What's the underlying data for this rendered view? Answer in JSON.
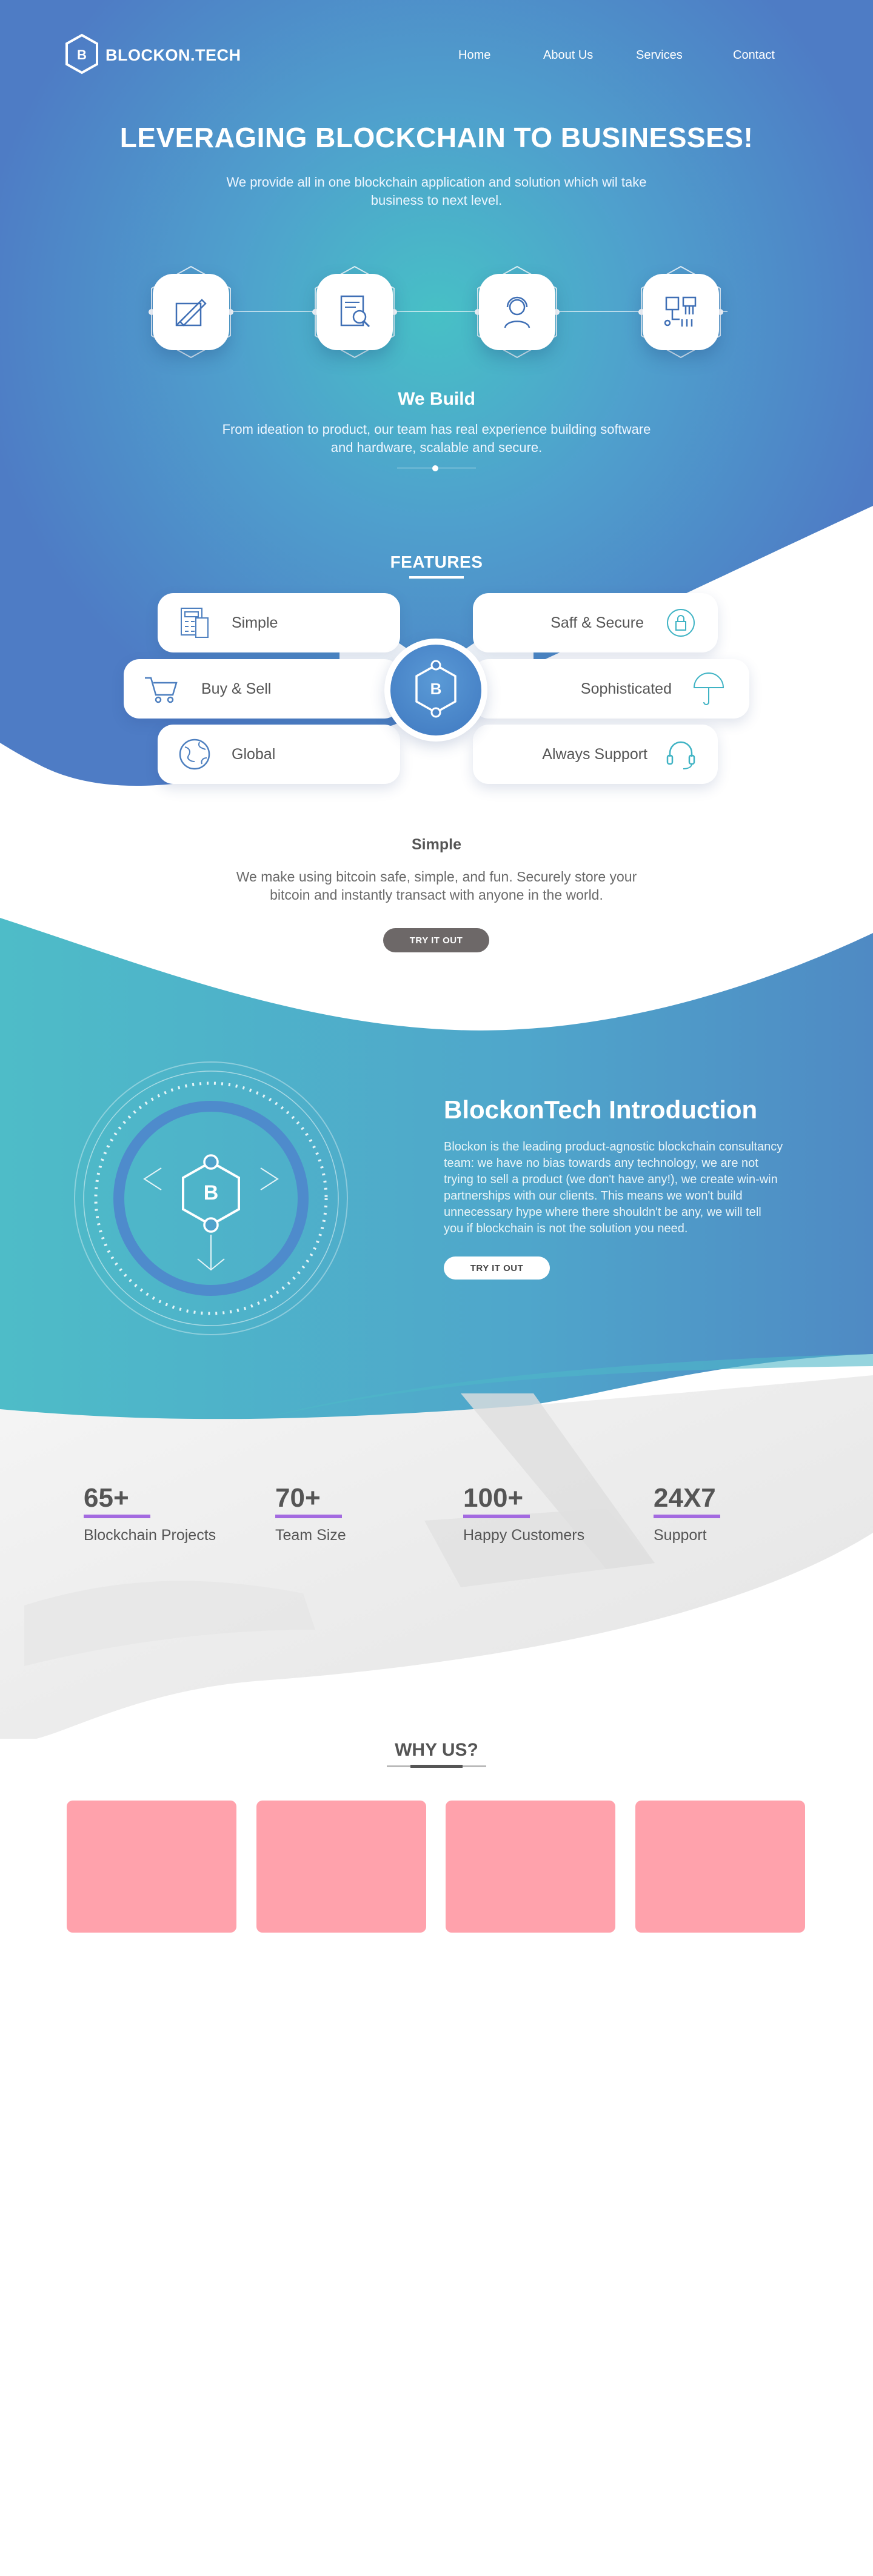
{
  "brand": {
    "name": "BLOCKON.TECH",
    "logo_letter": "B"
  },
  "nav": {
    "items": [
      "Home",
      "About Us",
      "Services",
      "Contact"
    ]
  },
  "hero": {
    "title": "LEVERAGING BLOCKCHAIN TO BUSINESSES!",
    "subtitle": "We provide all in one blockchain application and solution which wil take business to next level.",
    "steps": [
      "pencil-ruler-icon",
      "document-search-icon",
      "support-agent-icon",
      "circuit-icon"
    ],
    "build_title": "We Build",
    "build_text": "From ideation to product, our team has real experience building software and hardware, scalable and secure."
  },
  "features": {
    "title": "FEATURES",
    "hub_letter": "B",
    "items": {
      "simple": "Simple",
      "buy_sell": "Buy & Sell",
      "global": "Global",
      "safe": "Saff & Secure",
      "sophisticated": "Sophisticated",
      "support": "Always Support"
    }
  },
  "simple": {
    "title": "Simple",
    "text": "We make using bitcoin safe, simple, and fun. Securely store your bitcoin and instantly transact with anyone in the world.",
    "button": "TRY IT OUT"
  },
  "intro": {
    "title": "BlockonTech Introduction",
    "text": "Blockon is the leading product-agnostic blockchain consultancy team: we have no bias towards any technology, we are not trying to sell a product (we don't have any!), we create win-win partnerships with our clients. This means we won't build unnecessary hype where there shouldn't be any, we will tell you if blockchain is not the solution you need.",
    "button": "TRY IT OUT",
    "logo_letter": "B"
  },
  "stats": [
    {
      "num": "65+",
      "label": "Blockchain Projects"
    },
    {
      "num": "70+",
      "label": "Team Size"
    },
    {
      "num": "100+",
      "label": "Happy Customers"
    },
    {
      "num": "24X7",
      "label": "Support"
    }
  ],
  "why": {
    "title": "WHY US?"
  },
  "colors": {
    "blue": "#4f7fc4",
    "teal": "#4bbdc8",
    "accent": "#a36ae0",
    "card": "#ffa2ac"
  }
}
